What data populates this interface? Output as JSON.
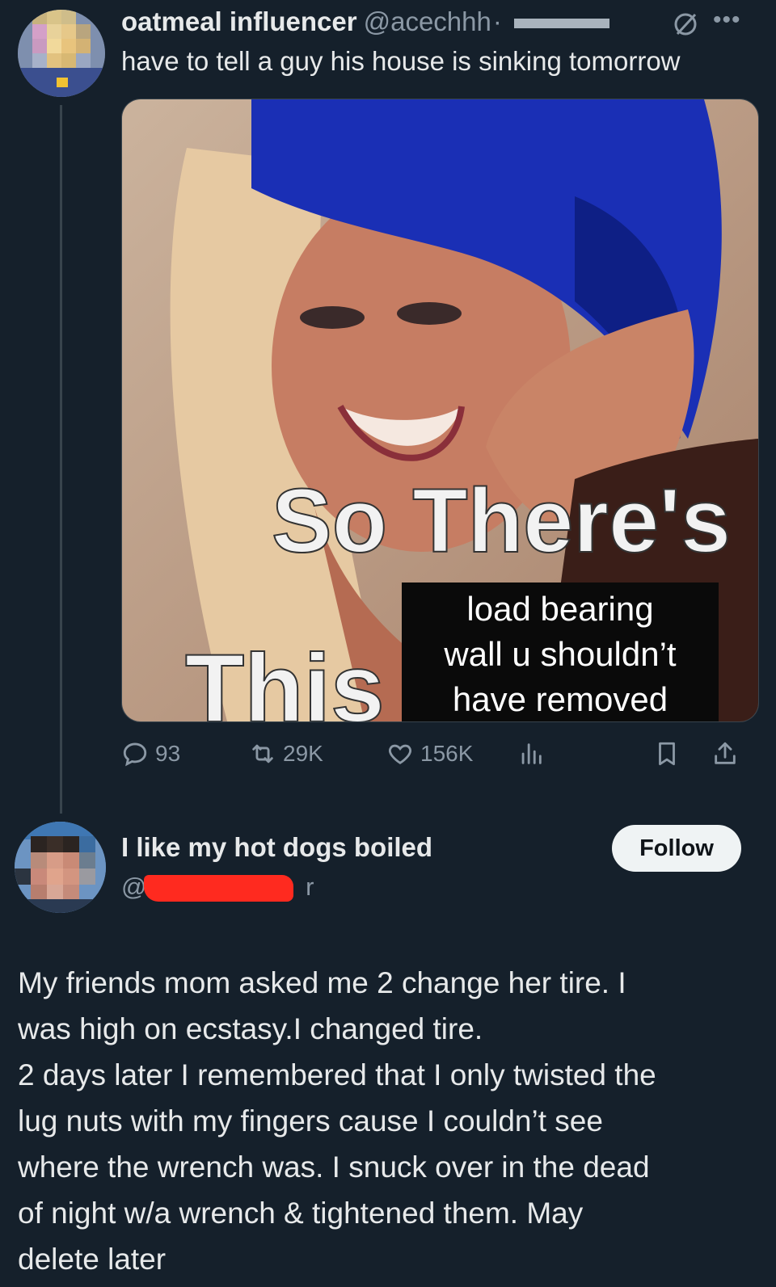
{
  "tweet1": {
    "display_name": "oatmeal influencer",
    "handle": "@acechhh",
    "separator": "·",
    "text": "have to tell a guy his house is sinking tomorrow",
    "media": {
      "caption_top": "So There's",
      "caption_bottom": "This",
      "box_lines": [
        "load bearing",
        "wall u shouldn’t",
        "have removed"
      ]
    },
    "stats": {
      "replies": "93",
      "retweets": "29K",
      "likes": "156K"
    },
    "icons": {
      "reply": "reply-icon",
      "retweet": "retweet-icon",
      "like": "heart-icon",
      "views": "views-bar-icon",
      "bookmark": "bookmark-icon",
      "share": "share-icon",
      "more": "more-icon"
    }
  },
  "tweet2": {
    "display_name": "I like my hot dogs boiled",
    "handle_prefix": "@",
    "handle_suffix": "r",
    "follow_label": "Follow",
    "text_lines": [
      "My friends mom asked me 2 change her tire. I",
      "was high on ecstasy.I changed tire.",
      "2 days later I remembered that I only twisted the",
      "lug nuts with my fingers cause I couldn’t see",
      "where the wrench was. I snuck over in the dead",
      "of night w/a wrench & tightened them. May",
      "delete later"
    ]
  },
  "colors": {
    "background": "#15202b",
    "text": "#e7e9ea",
    "muted": "#8b98a5",
    "follow_bg": "#eff3f4",
    "redaction_red": "#ff2a1f"
  }
}
